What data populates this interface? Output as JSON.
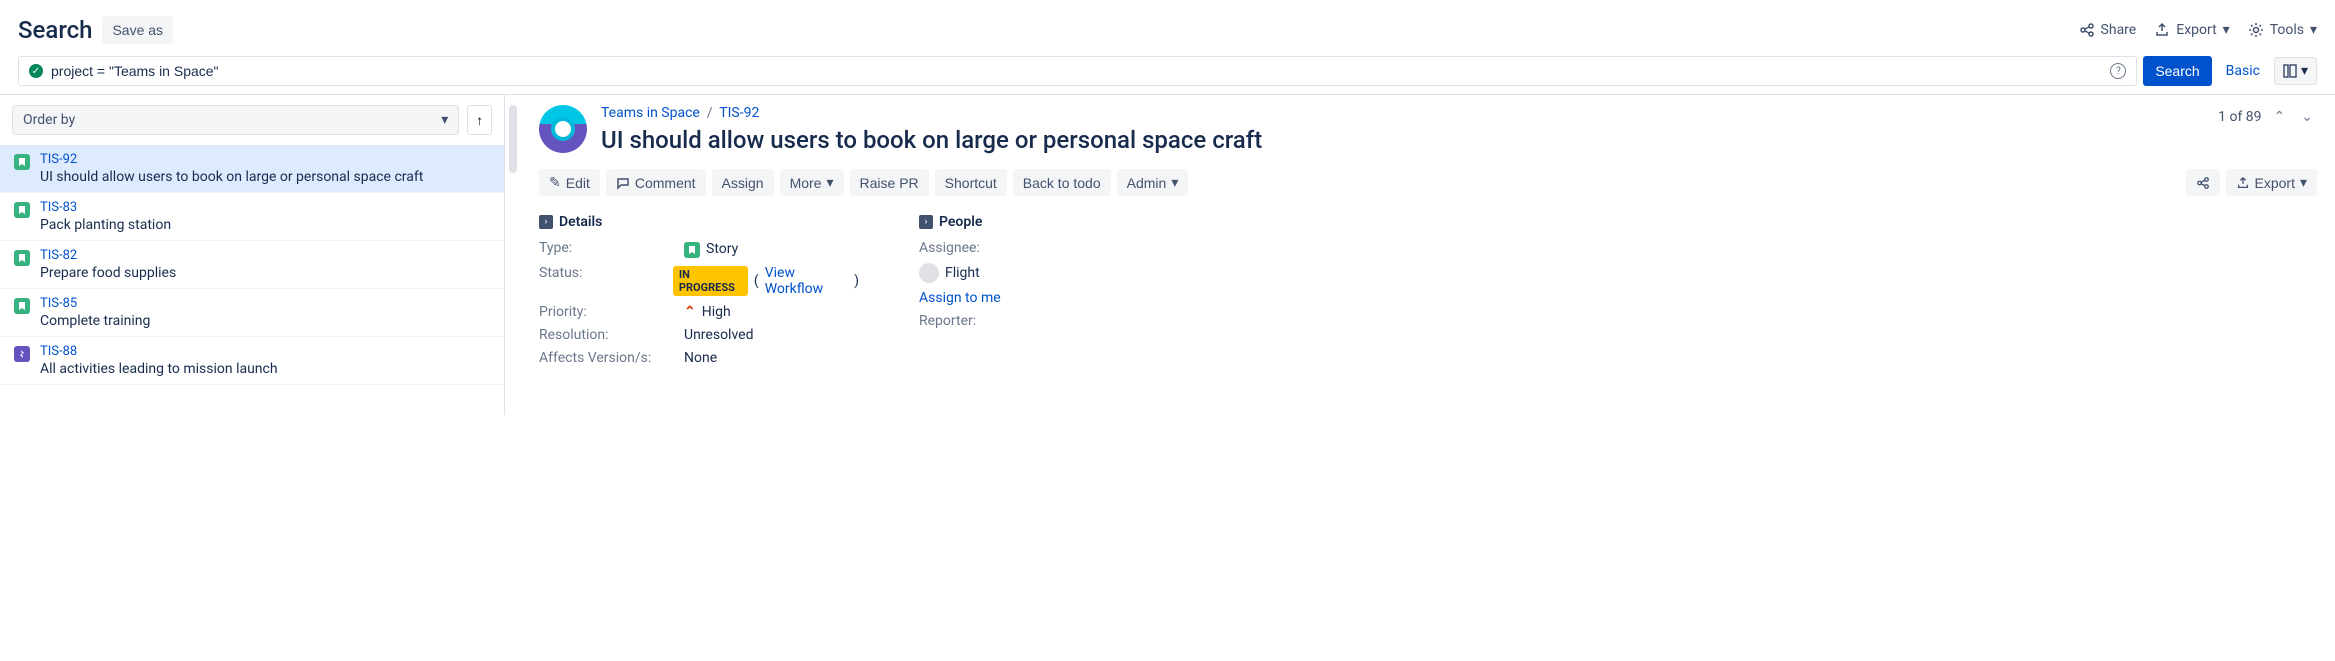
{
  "header": {
    "title": "Search",
    "save_as": "Save as",
    "share": "Share",
    "export": "Export",
    "tools": "Tools"
  },
  "search": {
    "jql": "project = \"Teams in Space\"",
    "search_btn": "Search",
    "basic": "Basic"
  },
  "order": {
    "label": "Order by"
  },
  "issues": [
    {
      "key": "TIS-92",
      "summary": "UI should allow users to book on large or personal space craft",
      "type": "story",
      "selected": true
    },
    {
      "key": "TIS-83",
      "summary": "Pack planting station",
      "type": "story",
      "selected": false
    },
    {
      "key": "TIS-82",
      "summary": "Prepare food supplies",
      "type": "story",
      "selected": false
    },
    {
      "key": "TIS-85",
      "summary": "Complete training",
      "type": "story",
      "selected": false
    },
    {
      "key": "TIS-88",
      "summary": "All activities leading to mission launch",
      "type": "epic",
      "selected": false
    }
  ],
  "detail": {
    "project": "Teams in Space",
    "key": "TIS-92",
    "title": "UI should allow users to book on large or personal space craft",
    "pager": "1 of 89",
    "toolbar": {
      "edit": "Edit",
      "comment": "Comment",
      "assign": "Assign",
      "more": "More",
      "raise_pr": "Raise PR",
      "shortcut": "Shortcut",
      "back_to_todo": "Back to todo",
      "admin": "Admin",
      "export": "Export"
    },
    "sections": {
      "details": "Details",
      "people": "People"
    },
    "fields": {
      "type_label": "Type:",
      "type_value": "Story",
      "status_label": "Status:",
      "status_value": "IN PROGRESS",
      "view_workflow": "View Workflow",
      "priority_label": "Priority:",
      "priority_value": "High",
      "resolution_label": "Resolution:",
      "resolution_value": "Unresolved",
      "affects_label": "Affects Version/s:",
      "affects_value": "None",
      "assignee_label": "Assignee:",
      "assignee_value": "Flight",
      "assign_to_me": "Assign to me",
      "reporter_label": "Reporter:"
    }
  }
}
